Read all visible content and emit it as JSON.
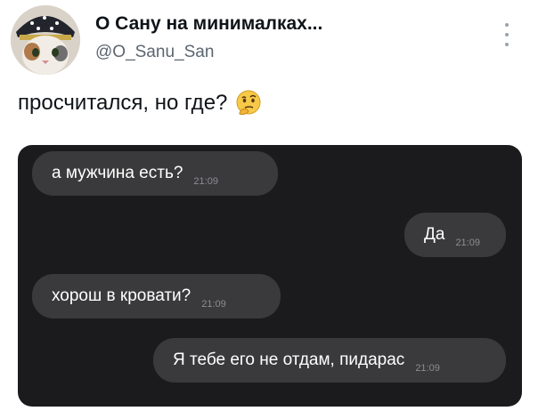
{
  "header": {
    "name": "О Сану на минималках...",
    "handle": "@O_Sanu_San"
  },
  "tweet": {
    "text": "просчитался, но где?",
    "emoji": "thinking-face-emoji"
  },
  "chat": {
    "messages": [
      {
        "text": "а мужчина есть?",
        "time": "21:09",
        "side": "left"
      },
      {
        "text": "Да",
        "time": "21:09",
        "side": "right"
      },
      {
        "text": "хорош в кровати?",
        "time": "21:09",
        "side": "left"
      },
      {
        "text": "Я тебе его не отдам, пидарас",
        "time": "21:09",
        "side": "right"
      }
    ]
  },
  "colors": {
    "chat_background": "#1b1b1d",
    "bubble": "#3a3a3c",
    "timestamp": "#8d8d92"
  }
}
